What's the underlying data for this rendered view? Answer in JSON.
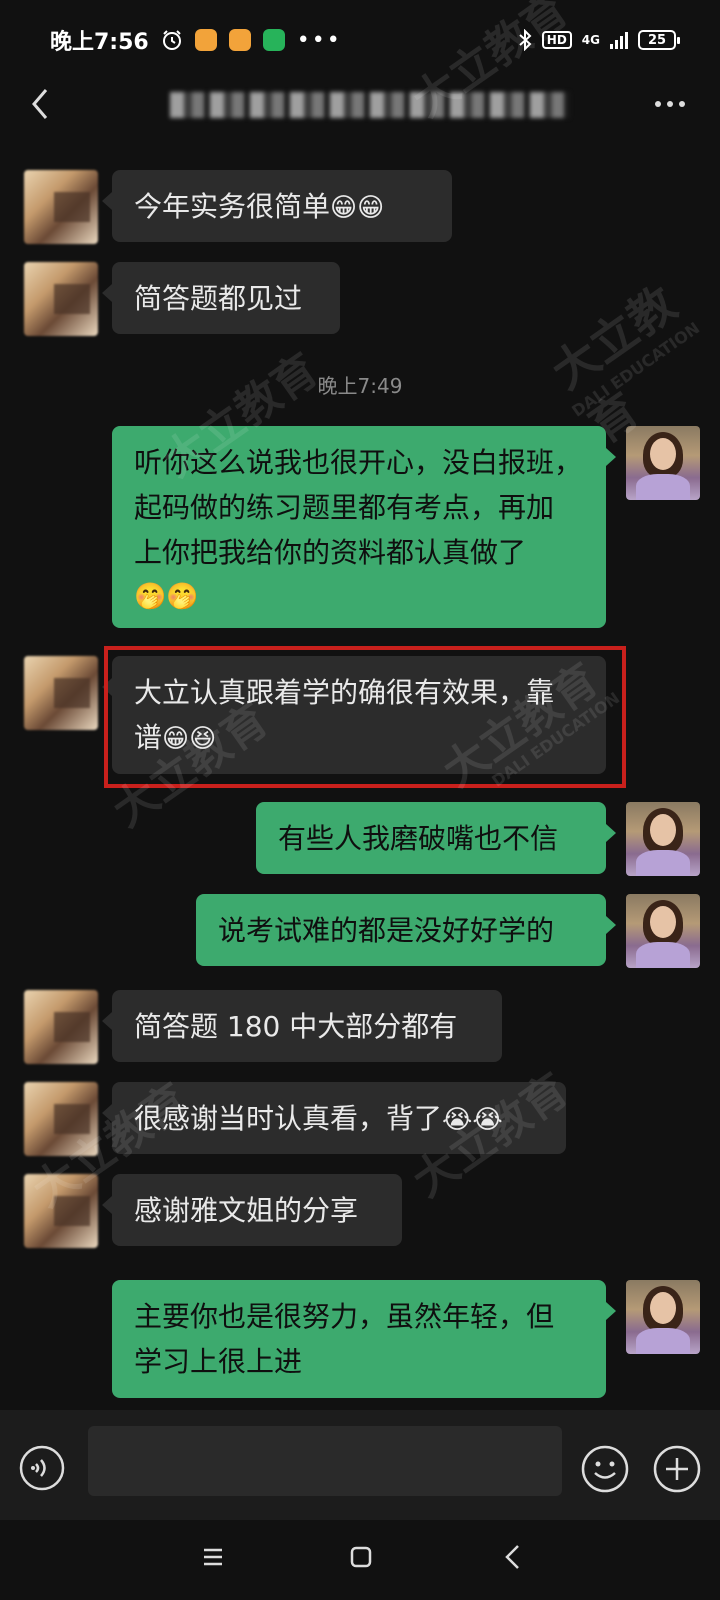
{
  "status_bar": {
    "time": "晚上7:56",
    "network": "4G",
    "hd": "HD",
    "battery": "25"
  },
  "nav": {
    "title": "▚▞▟▙▞▚▟▞▙▚"
  },
  "messages": [
    {
      "from": "other",
      "text": "今年实务很简单",
      "emoji": "😁😁"
    },
    {
      "from": "other",
      "text": "简答题都见过",
      "emoji": ""
    },
    {
      "type": "timestamp",
      "text": "晚上7:49"
    },
    {
      "from": "me",
      "lines": [
        "听你这么说我也很开心，没白报班，",
        "起码做的练习题里都有考点，再加",
        "上你把我给你的资料都认真做了"
      ],
      "emoji": "🤭🤭"
    },
    {
      "from": "other",
      "lines": [
        "大立认真跟着学的确很有效果，靠",
        "谱"
      ],
      "emoji": "😁😆",
      "highlighted": true
    },
    {
      "from": "me",
      "text": "有些人我磨破嘴也不信",
      "emoji": ""
    },
    {
      "from": "me",
      "text": "说考试难的都是没好好学的",
      "emoji": ""
    },
    {
      "from": "other",
      "text": "简答题 180 中大部分都有",
      "emoji": ""
    },
    {
      "from": "other",
      "text": "很感谢当时认真看，背了",
      "emoji": "😭😭"
    },
    {
      "from": "other",
      "text": "感谢雅文姐的分享",
      "emoji": ""
    },
    {
      "from": "me",
      "lines": [
        "主要你也是很努力，虽然年轻，但",
        "学习上很上进"
      ],
      "emoji": ""
    }
  ],
  "watermark": {
    "cn": "大立教育",
    "en": "DALI EDUCATION"
  },
  "input": {
    "placeholder": ""
  },
  "colors": {
    "background": "#111111",
    "bubble_in": "#2c2c2c",
    "bubble_out": "#3daa6e",
    "highlight": "#c9201c"
  }
}
